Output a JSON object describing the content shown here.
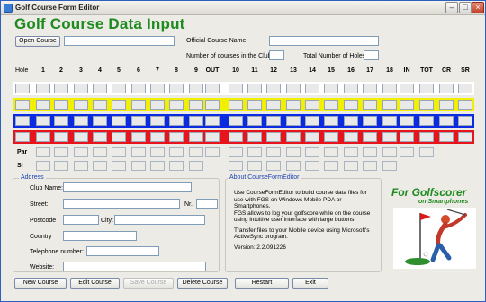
{
  "window": {
    "title": "Golf Course Form Editor"
  },
  "heading": "Golf Course Data Input",
  "top": {
    "open_course": "Open Course",
    "official_name_label": "Official Course Name:",
    "courses_in_club_label": "Number of courses in the Club:",
    "total_holes_label": "Total Number of Holes:"
  },
  "grid": {
    "hole_label": "Hole",
    "columns": [
      "1",
      "2",
      "3",
      "4",
      "5",
      "6",
      "7",
      "8",
      "9",
      "OUT",
      "10",
      "11",
      "12",
      "13",
      "14",
      "15",
      "16",
      "17",
      "18",
      "IN",
      "TOT",
      "CR",
      "SR"
    ],
    "tee_rows": [
      "white",
      "yellow",
      "blue",
      "red"
    ],
    "par_label": "Par",
    "si_label": "SI"
  },
  "address": {
    "legend": "Address",
    "club_name": "Club Name:",
    "street": "Street:",
    "nr": "Nr.",
    "postcode": "Postcode",
    "city": "City:",
    "country": "Country",
    "telephone": "Telephone number:",
    "website": "Website:"
  },
  "about": {
    "legend": "About CourseFormEditor",
    "lines": [
      "Use CourseFormEditor to build course data files for",
      "use with FGS on Windows Mobile PDA or",
      "Smartphones.",
      "FGS allows to log your golfscore while on the course",
      "using intuitive user interface with large buttons.",
      "",
      "Transfer files to your Mobile device using Microsoft's",
      "ActiveSync program.",
      "",
      "Version:     2.2.091226"
    ]
  },
  "branding": {
    "title": "For Golfscorer",
    "subtitle": "on Smartphones"
  },
  "buttons": {
    "new_course": "New Course",
    "edit_course": "Edit Course",
    "save_course": "Save Course",
    "delete_course": "Delete Course",
    "restart": "Restart",
    "exit": "Exit"
  },
  "colors": {
    "heading": "#1f8a1f",
    "yellow_tee": "#f2ef00",
    "blue_tee": "#0a2be0",
    "red_tee": "#e8141c",
    "white_tee": "#ffffff"
  },
  "icons": [
    "app-icon",
    "minimize-icon",
    "maximize-icon",
    "close-icon",
    "golfer-logo-icon"
  ]
}
